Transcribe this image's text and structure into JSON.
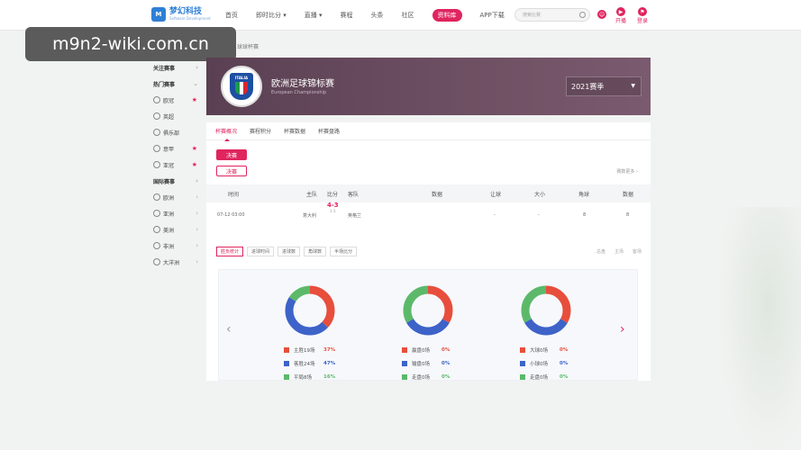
{
  "header": {
    "logo_mark": "M",
    "logo_name": "梦幻科技",
    "logo_sub": "Software Development",
    "nav": [
      "首页",
      "即时比分 ▾",
      "直播 ▾",
      "赛程",
      "头条",
      "社区",
      "资料库",
      "APP下载"
    ],
    "active_nav_index": 6,
    "search_placeholder": "搜索比赛",
    "open_label": "开播",
    "login_label": "登录"
  },
  "watermark": "m9n2-wiki.com.cn",
  "breadcrumb": "球球杯赛",
  "sidebar": [
    {
      "label": "关注赛事",
      "type": "section",
      "chev": "›"
    },
    {
      "label": "热门赛事",
      "type": "section",
      "chev": "⌄"
    },
    {
      "label": "欧冠",
      "type": "item",
      "star": true
    },
    {
      "label": "英超",
      "type": "item",
      "star": false
    },
    {
      "label": "俱乐部",
      "type": "item",
      "star": false
    },
    {
      "label": "意甲",
      "type": "item",
      "star": true
    },
    {
      "label": "亚冠",
      "type": "item",
      "star": true
    },
    {
      "label": "国际赛事",
      "type": "section",
      "chev": "›"
    },
    {
      "label": "欧洲",
      "type": "item",
      "chev": "›"
    },
    {
      "label": "亚洲",
      "type": "item",
      "chev": "›"
    },
    {
      "label": "美洲",
      "type": "item",
      "chev": "›"
    },
    {
      "label": "非洲",
      "type": "item",
      "chev": "›"
    },
    {
      "label": "大洋洲",
      "type": "item",
      "chev": "›"
    }
  ],
  "banner": {
    "badge_text": "ITALIA",
    "title": "欧洲足球锦标赛",
    "subtitle": "European Championship",
    "season": "2021赛季",
    "season_arrow": "▼",
    "flag_colors": [
      "#1c9a4c",
      "#ffffff",
      "#d8262d"
    ]
  },
  "tabs": [
    "杯赛概况",
    "赛程积分",
    "杯赛数据",
    "杯赛盘路"
  ],
  "active_tab_index": 0,
  "stage_buttons": [
    "决赛",
    "决赛"
  ],
  "right_link": "赛数更多 ›",
  "table": {
    "headers": [
      "时间",
      "主队",
      "比分",
      "客队",
      "数据",
      "让球",
      "大小",
      "角球",
      "数据"
    ],
    "row": {
      "time": "07-12 03:00",
      "home": "意大利",
      "score": "4-3",
      "score_sub": "1-1",
      "away": "英格兰",
      "handicap": "-",
      "ou": "-",
      "corner": "8",
      "data": "8"
    }
  },
  "stat_tabs": [
    "胜负统计",
    "进球时间",
    "进球数",
    "角球数",
    "半场比分"
  ],
  "active_stat_index": 0,
  "stat_links": [
    "总盘",
    "主场",
    "客场"
  ],
  "carousel": {
    "prev": "‹",
    "next": "›"
  },
  "colors": {
    "accent": "#e0245e",
    "red": "#e84e3c",
    "blue": "#3d63c9",
    "green": "#5cb96a"
  },
  "donuts": [
    {
      "segments": [
        0.37,
        0.47,
        0.16
      ],
      "legend": [
        {
          "label": "主胜19场",
          "pct": "37%"
        },
        {
          "label": "客胜24场",
          "pct": "47%"
        },
        {
          "label": "平局8场",
          "pct": "16%"
        }
      ]
    },
    {
      "segments": [
        0.0,
        0.0,
        0.0
      ],
      "legend": [
        {
          "label": "赢盘0场",
          "pct": "0%"
        },
        {
          "label": "输盘0场",
          "pct": "0%"
        },
        {
          "label": "走盘0场",
          "pct": "0%"
        }
      ]
    },
    {
      "segments": [
        0.0,
        0.0,
        0.0
      ],
      "legend": [
        {
          "label": "大球0场",
          "pct": "0%"
        },
        {
          "label": "小球0场",
          "pct": "0%"
        },
        {
          "label": "走盘0场",
          "pct": "0%"
        }
      ]
    }
  ]
}
